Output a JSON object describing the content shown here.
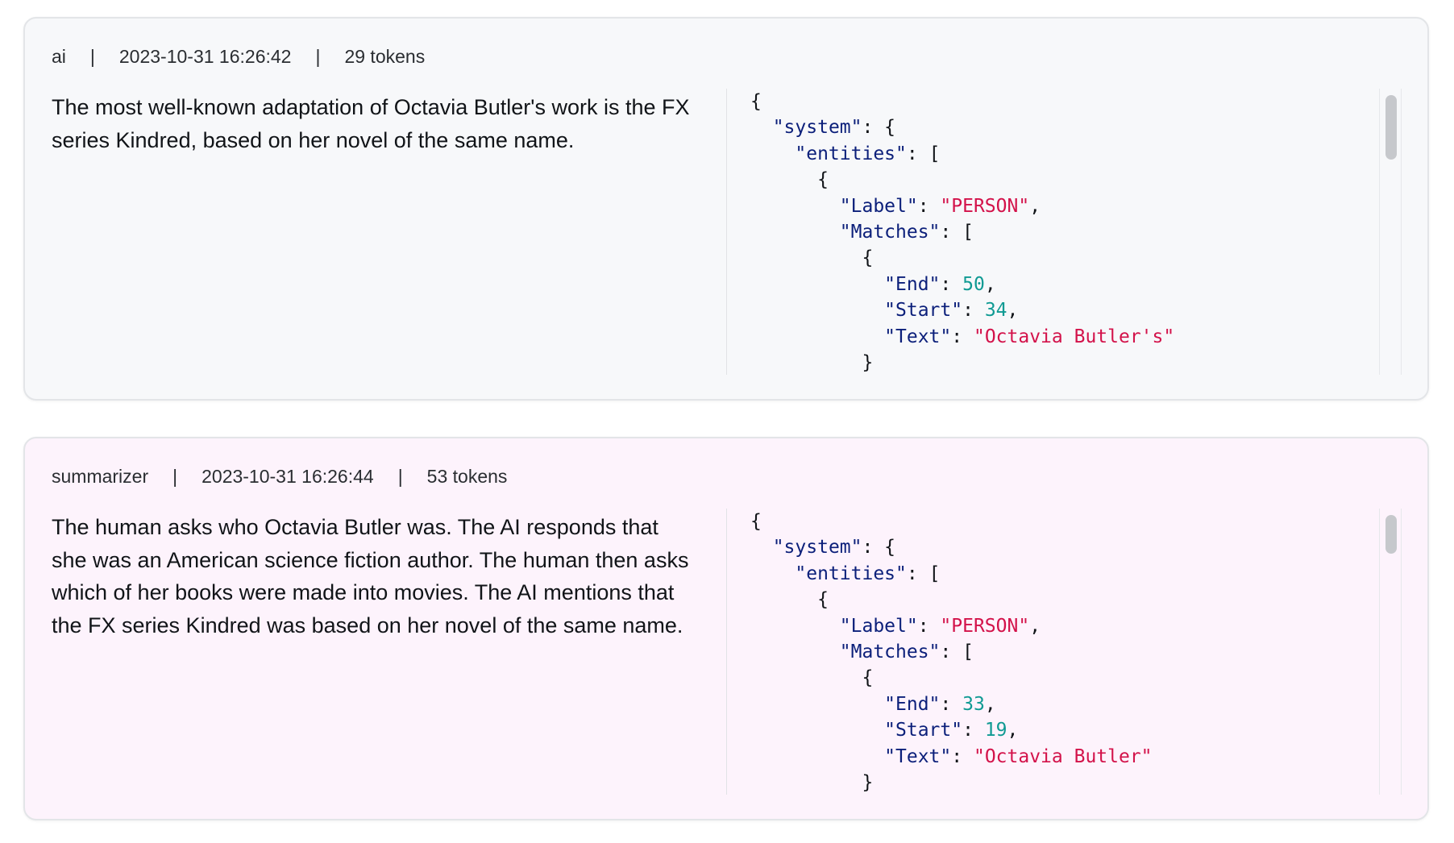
{
  "messages": [
    {
      "role": "ai",
      "timestamp": "2023-10-31 16:26:42",
      "tokens": "29 tokens",
      "separator": "|",
      "text": "The most well-known adaptation of Octavia Butler's work is the FX series Kindred, based on her novel of the same name.",
      "background": "#f7f8fa",
      "json_lines": [
        [
          {
            "t": "p",
            "v": "{"
          }
        ],
        [
          {
            "t": "p",
            "v": "  "
          },
          {
            "t": "key",
            "v": "\"system\""
          },
          {
            "t": "p",
            "v": ": {"
          }
        ],
        [
          {
            "t": "p",
            "v": "    "
          },
          {
            "t": "key",
            "v": "\"entities\""
          },
          {
            "t": "p",
            "v": ": ["
          }
        ],
        [
          {
            "t": "p",
            "v": "      {"
          }
        ],
        [
          {
            "t": "p",
            "v": "        "
          },
          {
            "t": "key",
            "v": "\"Label\""
          },
          {
            "t": "p",
            "v": ": "
          },
          {
            "t": "str",
            "v": "\"PERSON\""
          },
          {
            "t": "p",
            "v": ","
          }
        ],
        [
          {
            "t": "p",
            "v": "        "
          },
          {
            "t": "key",
            "v": "\"Matches\""
          },
          {
            "t": "p",
            "v": ": ["
          }
        ],
        [
          {
            "t": "p",
            "v": "          {"
          }
        ],
        [
          {
            "t": "p",
            "v": "            "
          },
          {
            "t": "key",
            "v": "\"End\""
          },
          {
            "t": "p",
            "v": ": "
          },
          {
            "t": "num",
            "v": "50"
          },
          {
            "t": "p",
            "v": ","
          }
        ],
        [
          {
            "t": "p",
            "v": "            "
          },
          {
            "t": "key",
            "v": "\"Start\""
          },
          {
            "t": "p",
            "v": ": "
          },
          {
            "t": "num",
            "v": "34"
          },
          {
            "t": "p",
            "v": ","
          }
        ],
        [
          {
            "t": "p",
            "v": "            "
          },
          {
            "t": "key",
            "v": "\"Text\""
          },
          {
            "t": "p",
            "v": ": "
          },
          {
            "t": "str",
            "v": "\"Octavia Butler's\""
          }
        ],
        [
          {
            "t": "p",
            "v": "          }"
          }
        ]
      ]
    },
    {
      "role": "summarizer",
      "timestamp": "2023-10-31 16:26:44",
      "tokens": "53 tokens",
      "separator": "|",
      "text": "The human asks who Octavia Butler was. The AI responds that she was an American science fiction author. The human then asks which of her books were made into movies. The AI mentions that the FX series Kindred was based on her novel of the same name.",
      "background": "#fdf3fc",
      "json_lines": [
        [
          {
            "t": "p",
            "v": "{"
          }
        ],
        [
          {
            "t": "p",
            "v": "  "
          },
          {
            "t": "key",
            "v": "\"system\""
          },
          {
            "t": "p",
            "v": ": {"
          }
        ],
        [
          {
            "t": "p",
            "v": "    "
          },
          {
            "t": "key",
            "v": "\"entities\""
          },
          {
            "t": "p",
            "v": ": ["
          }
        ],
        [
          {
            "t": "p",
            "v": "      {"
          }
        ],
        [
          {
            "t": "p",
            "v": "        "
          },
          {
            "t": "key",
            "v": "\"Label\""
          },
          {
            "t": "p",
            "v": ": "
          },
          {
            "t": "str",
            "v": "\"PERSON\""
          },
          {
            "t": "p",
            "v": ","
          }
        ],
        [
          {
            "t": "p",
            "v": "        "
          },
          {
            "t": "key",
            "v": "\"Matches\""
          },
          {
            "t": "p",
            "v": ": ["
          }
        ],
        [
          {
            "t": "p",
            "v": "          {"
          }
        ],
        [
          {
            "t": "p",
            "v": "            "
          },
          {
            "t": "key",
            "v": "\"End\""
          },
          {
            "t": "p",
            "v": ": "
          },
          {
            "t": "num",
            "v": "33"
          },
          {
            "t": "p",
            "v": ","
          }
        ],
        [
          {
            "t": "p",
            "v": "            "
          },
          {
            "t": "key",
            "v": "\"Start\""
          },
          {
            "t": "p",
            "v": ": "
          },
          {
            "t": "num",
            "v": "19"
          },
          {
            "t": "p",
            "v": ","
          }
        ],
        [
          {
            "t": "p",
            "v": "            "
          },
          {
            "t": "key",
            "v": "\"Text\""
          },
          {
            "t": "p",
            "v": ": "
          },
          {
            "t": "str",
            "v": "\"Octavia Butler\""
          }
        ],
        [
          {
            "t": "p",
            "v": "          }"
          }
        ]
      ]
    }
  ],
  "colors": {
    "json_key": "#0b1f7a",
    "json_string": "#d3124a",
    "json_number": "#0f9a93"
  }
}
